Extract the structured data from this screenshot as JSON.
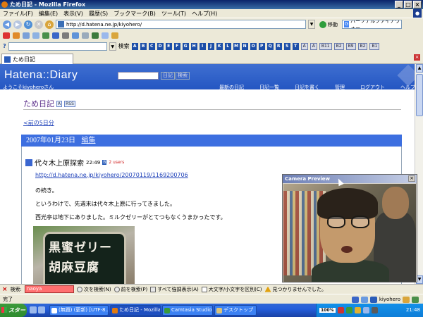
{
  "window": {
    "title": "ため日記 - Mozilla Firefox",
    "controls": [
      "_",
      "□",
      "×"
    ]
  },
  "menu": [
    "ファイル(F)",
    "編集(E)",
    "表示(V)",
    "履歴(S)",
    "ブックマーク(B)",
    "ツール(T)",
    "ヘルプ(H)"
  ],
  "nav": {
    "url": "http://d.hatena.ne.jp/kiyohero/",
    "go_label": "移動",
    "search_engine_placeholder": "パーソナルファイアウォー..."
  },
  "searchbar": {
    "label": "検索",
    "letters": [
      "A",
      "B",
      "C",
      "D",
      "E",
      "F",
      "G",
      "H",
      "I",
      "J",
      "K",
      "L",
      "M",
      "N",
      "O",
      "P",
      "Q",
      "R",
      "S",
      "T"
    ],
    "right_buttons": [
      "A",
      "A",
      "B11",
      "B2",
      "B9",
      "B2",
      "B1"
    ]
  },
  "tabs": [
    {
      "label": "ため日記"
    }
  ],
  "hatena": {
    "logo": "Hatena::Diary",
    "search_btn1": "日記",
    "search_btn2": "検索",
    "welcome": "ようこそkiyoheroさん",
    "nav": [
      "最新の日記",
      "日記一覧",
      "日記を書く",
      "管理",
      "ログアウト",
      "ヘルプ"
    ]
  },
  "diary": {
    "title": "ため日記",
    "badge1": "A",
    "badge2": "RSS",
    "prev_link": "<前の5日分",
    "date": "2007年01月23日",
    "edit": "編集",
    "entry_title": "代々木上原探索",
    "entry_time": "22:49",
    "entry_badge1": "B",
    "entry_badge2": "2 users",
    "entry_link": "http://d.hatena.ne.jp/kiyohero/20070119/1169200706",
    "lines": [
      "の続き。",
      "というわけで、先週末は代々木上原に行ってきました。",
      "西光亭は地下にありました。ミルクゼリーがとてつもなくうまかったです。"
    ],
    "sign_text": [
      "黒蜜ゼリー",
      "胡麻豆腐"
    ]
  },
  "camera": {
    "title": "Camera Preview",
    "close": "×"
  },
  "findbar": {
    "close": "×",
    "label": "検索:",
    "value": "naoya",
    "next": "次を検索(N)",
    "prev": "前を検索(P)",
    "highlight": "すべて強調表示(A)",
    "match_case": "大文字/小文字を区別(C)",
    "not_found": "見つかりませんでした。"
  },
  "status": {
    "text": "完了",
    "user": "kiyohero"
  },
  "taskbar": {
    "start": "スタート",
    "tasks": [
      "(無題) (更新) [UTF-8...",
      "ため日記 - Mozilla Fi...",
      "Camtasia Studio - U...",
      "デスクトップ"
    ],
    "zoom": "100%",
    "clock": "21:48"
  },
  "colors": {
    "hatena_blue": "#2d5ccc",
    "date_bar": "#3d6fe0",
    "find_not_found": "#ff6f6f",
    "taskbar": "#245edb"
  }
}
